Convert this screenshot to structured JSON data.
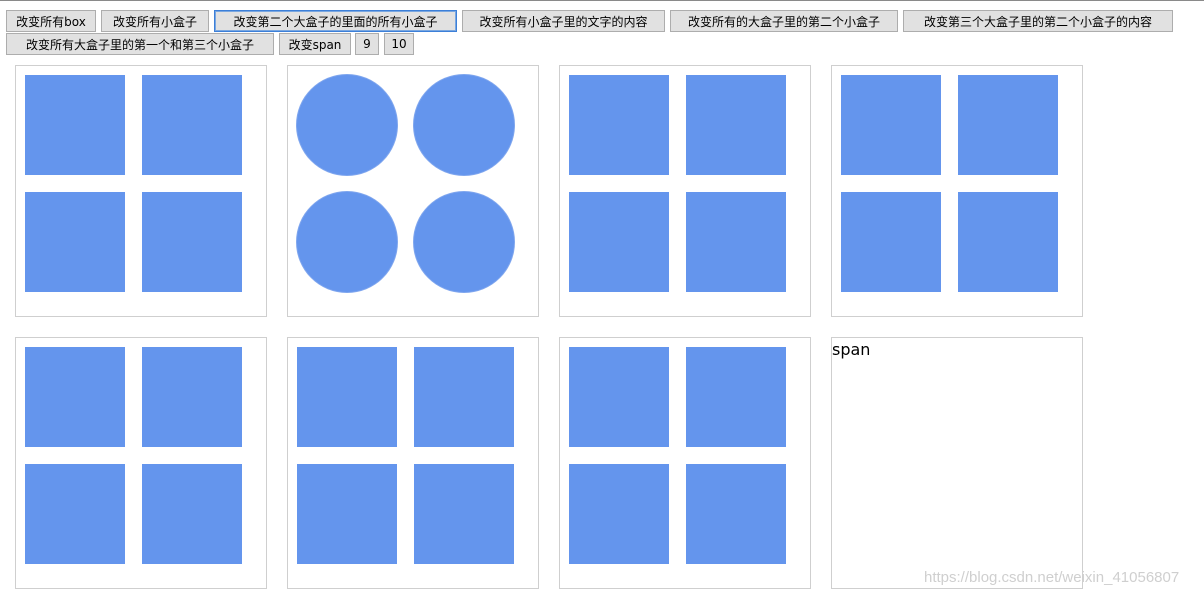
{
  "buttons_row1": [
    {
      "label": "改变所有box"
    },
    {
      "label": "改变所有小盒子"
    },
    {
      "label": "改变第二个大盒子的里面的所有小盒子"
    },
    {
      "label": "改变所有小盒子里的文字的内容"
    },
    {
      "label": "改变所有的大盒子里的第二个小盒子"
    },
    {
      "label": "改变第三个大盒子里的第二个小盒子的内容"
    }
  ],
  "buttons_row2": [
    {
      "label": "改变所有大盒子里的第一个和第三个小盒子"
    },
    {
      "label": "改变span"
    },
    {
      "label": "9"
    },
    {
      "label": "10"
    }
  ],
  "span_box": {
    "text": "span"
  },
  "colors": {
    "small_box": "#6495ed",
    "box_border": "#cfcfcf",
    "focus": "#3c7fd8"
  },
  "watermark": "https://blog.csdn.net/weixin_41056807"
}
